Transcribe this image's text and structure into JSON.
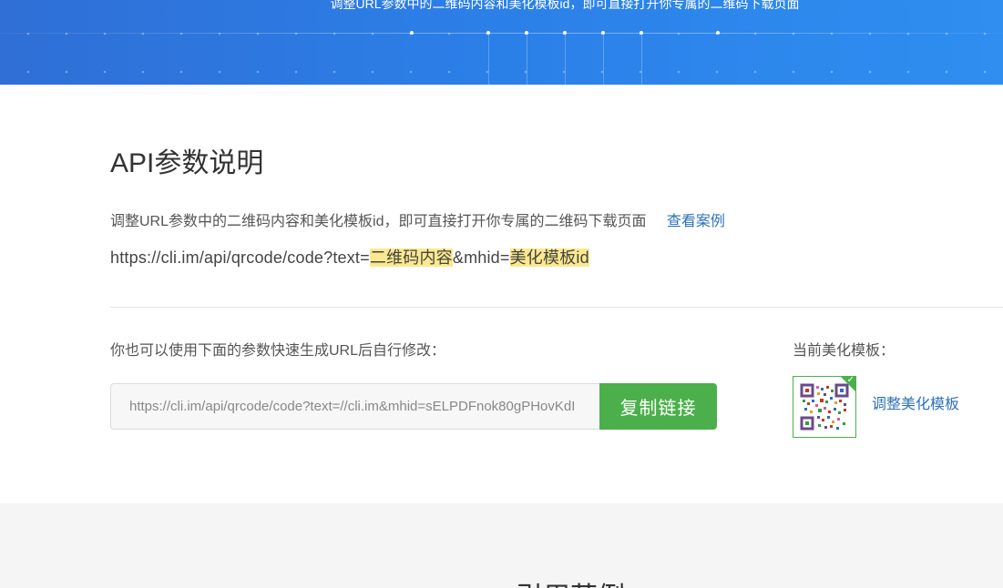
{
  "banner": {
    "subtitle": "调整URL参数中的二维码内容和美化模板id，即可直接打开你专属的二维码下载页面"
  },
  "api_section": {
    "title": "API参数说明",
    "description": "调整URL参数中的二维码内容和美化模板id，即可直接打开你专属的二维码下载页面",
    "example_link": "查看案例",
    "url_prefix": "https://cli.im/api/qrcode/code?text=",
    "param_content": "二维码内容",
    "url_middle": "&mhid=",
    "param_template": "美化模板id"
  },
  "quick_gen": {
    "label": "你也可以使用下面的参数快速生成URL后自行修改：",
    "url_value": "https://cli.im/api/qrcode/code?text=//cli.im&mhid=sELPDFnok80gPHovKdI",
    "copy_button": "复制链接"
  },
  "template_panel": {
    "label": "当前美化模板：",
    "adjust_link": "调整美化模板",
    "thumbnail_icon": "qr-template-thumbnail-icon",
    "selected_icon": "checkmark-icon"
  },
  "bottom_section": {
    "title": "引用范例"
  },
  "colors": {
    "banner_start": "#2f6fd6",
    "banner_end": "#2f8ef0",
    "highlight": "#fbe98f",
    "copy_button": "#4bb04b",
    "link": "#2c72b8"
  }
}
